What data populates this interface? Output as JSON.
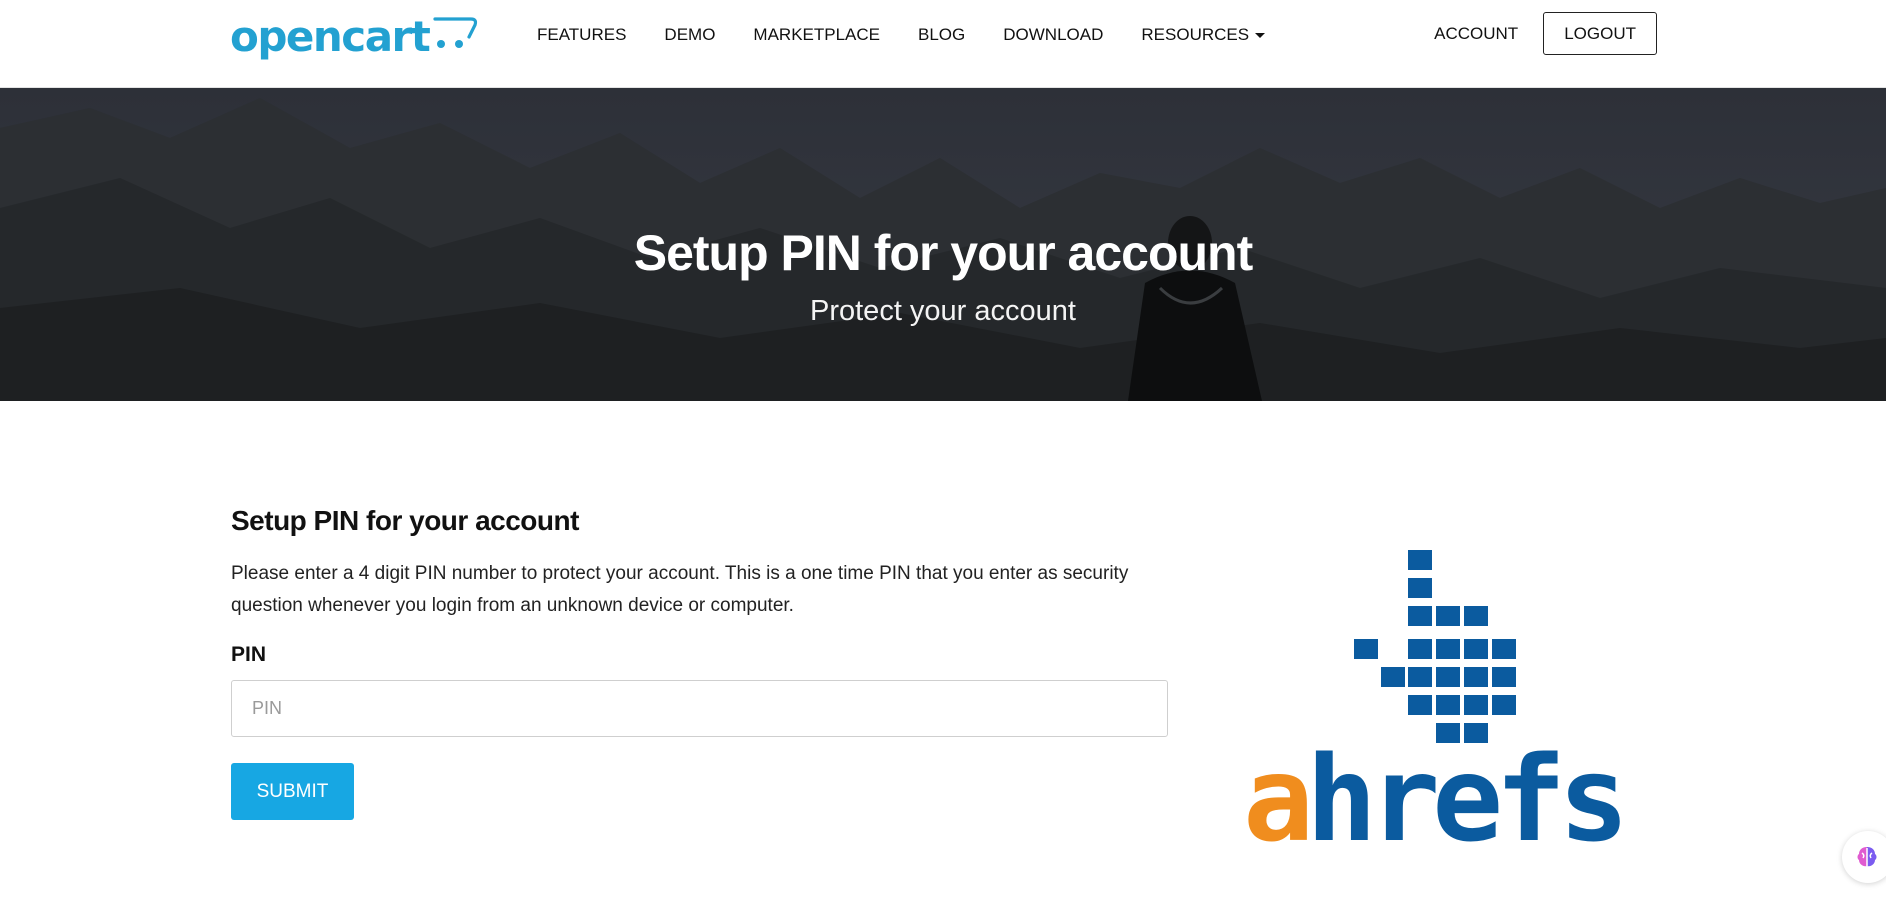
{
  "nav": {
    "logo_text": "opencart",
    "items": [
      "FEATURES",
      "DEMO",
      "MARKETPLACE",
      "BLOG",
      "DOWNLOAD",
      "RESOURCES"
    ],
    "account_label": "ACCOUNT",
    "logout_label": "LOGOUT"
  },
  "hero": {
    "title": "Setup PIN for your account",
    "subtitle": "Protect your account"
  },
  "form": {
    "title": "Setup PIN for your account",
    "description": "Please enter a 4 digit PIN number to protect your account. This is a one time PIN that you enter as security question whenever you login from an unknown device or computer.",
    "pin_label": "PIN",
    "pin_placeholder": "PIN",
    "pin_value": "",
    "submit_label": "SUBMIT"
  },
  "side_image": {
    "logo_text": "ahrefs",
    "logo_icon": "ahrefs-logo"
  },
  "floating_icon": "brain-icon",
  "colors": {
    "brand_blue": "#23a1d1",
    "submit_blue": "#17a7e3",
    "ahrefs_blue": "#0b5b9f",
    "ahrefs_orange": "#f08d1e"
  }
}
